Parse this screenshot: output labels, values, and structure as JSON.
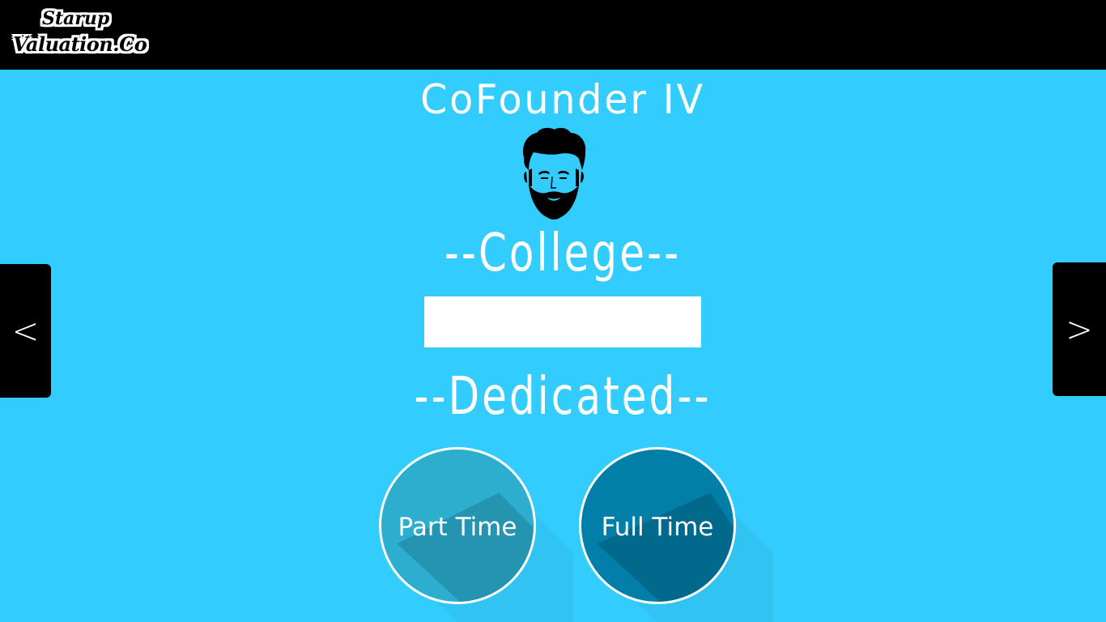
{
  "header": {
    "logo_line1": "Starup",
    "logo_line2": "Valuation.Co"
  },
  "page": {
    "title": "CoFounder IV",
    "avatar_icon": "bearded-man-icon",
    "college_label": "--College--",
    "college_value": "",
    "dedicated_label": "--Dedicated--"
  },
  "nav": {
    "prev_label": "<",
    "next_label": ">"
  },
  "options": [
    {
      "label": "Part Time",
      "color": "#2daece"
    },
    {
      "label": "Full Time",
      "color": "#027fa8"
    }
  ],
  "colors": {
    "background": "#33ccff",
    "topbar": "#000000",
    "accent_text": "#ffffff"
  }
}
